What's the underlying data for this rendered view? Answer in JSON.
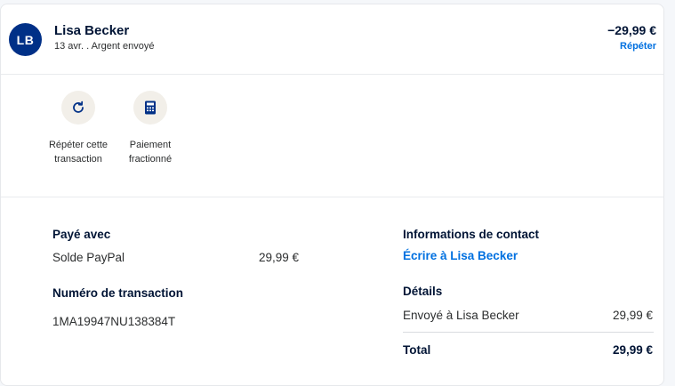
{
  "header": {
    "avatar_initials": "LB",
    "name": "Lisa Becker",
    "subline": "13 avr. . Argent envoyé",
    "amount": "−29,99 €",
    "repeat_link": "Répéter"
  },
  "actions": [
    {
      "label": "Répéter cette transaction",
      "icon": "refresh-icon"
    },
    {
      "label": "Paiement fractionné",
      "icon": "calculator-icon"
    }
  ],
  "payment": {
    "paid_with_title": "Payé avec",
    "method": "Solde PayPal",
    "method_amount": "29,99 €",
    "transaction_title": "Numéro de transaction",
    "transaction_id": "1MA19947NU138384T"
  },
  "contact": {
    "title": "Informations de contact",
    "write_link": "Écrire à Lisa Becker"
  },
  "details": {
    "title": "Détails",
    "row_label": "Envoyé à Lisa Becker",
    "row_amount": "29,99 €",
    "total_label": "Total",
    "total_amount": "29,99 €"
  },
  "colors": {
    "brand_navy": "#003087",
    "link_blue": "#0070e0",
    "icon_bg": "#f2efe9"
  }
}
